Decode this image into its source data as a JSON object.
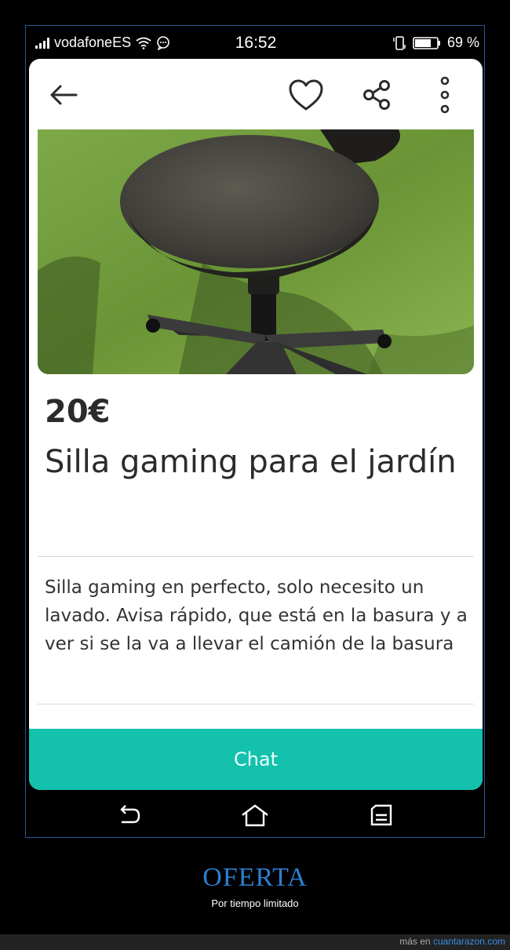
{
  "status_bar": {
    "carrier": "vodafoneES",
    "time": "16:52",
    "battery": "69 %"
  },
  "toolbar": {
    "back_icon": "arrow-left-icon",
    "favorite_icon": "heart-icon",
    "share_icon": "share-icon",
    "more_icon": "more-vertical-icon"
  },
  "listing": {
    "price": "20€",
    "title": "Silla gaming para el jardín",
    "description": "Silla gaming en perfecto, solo necesito un lavado. Avisa rápido, que está en la basura y a ver si se la va a llevar el camión de la basura"
  },
  "chat_button": {
    "label": "Chat"
  },
  "nav_bar": {
    "back_icon": "nav-back-icon",
    "home_icon": "nav-home-icon",
    "recents_icon": "nav-recents-icon"
  },
  "caption": {
    "title": "OFERTA",
    "subtitle": "Por tiempo limitado"
  },
  "footer": {
    "prefix": "más en ",
    "site": "cuantarazon.com"
  },
  "colors": {
    "accent": "#14c1ad",
    "caption_title": "#2b7fd0",
    "frame_border": "#1f5a9a"
  }
}
